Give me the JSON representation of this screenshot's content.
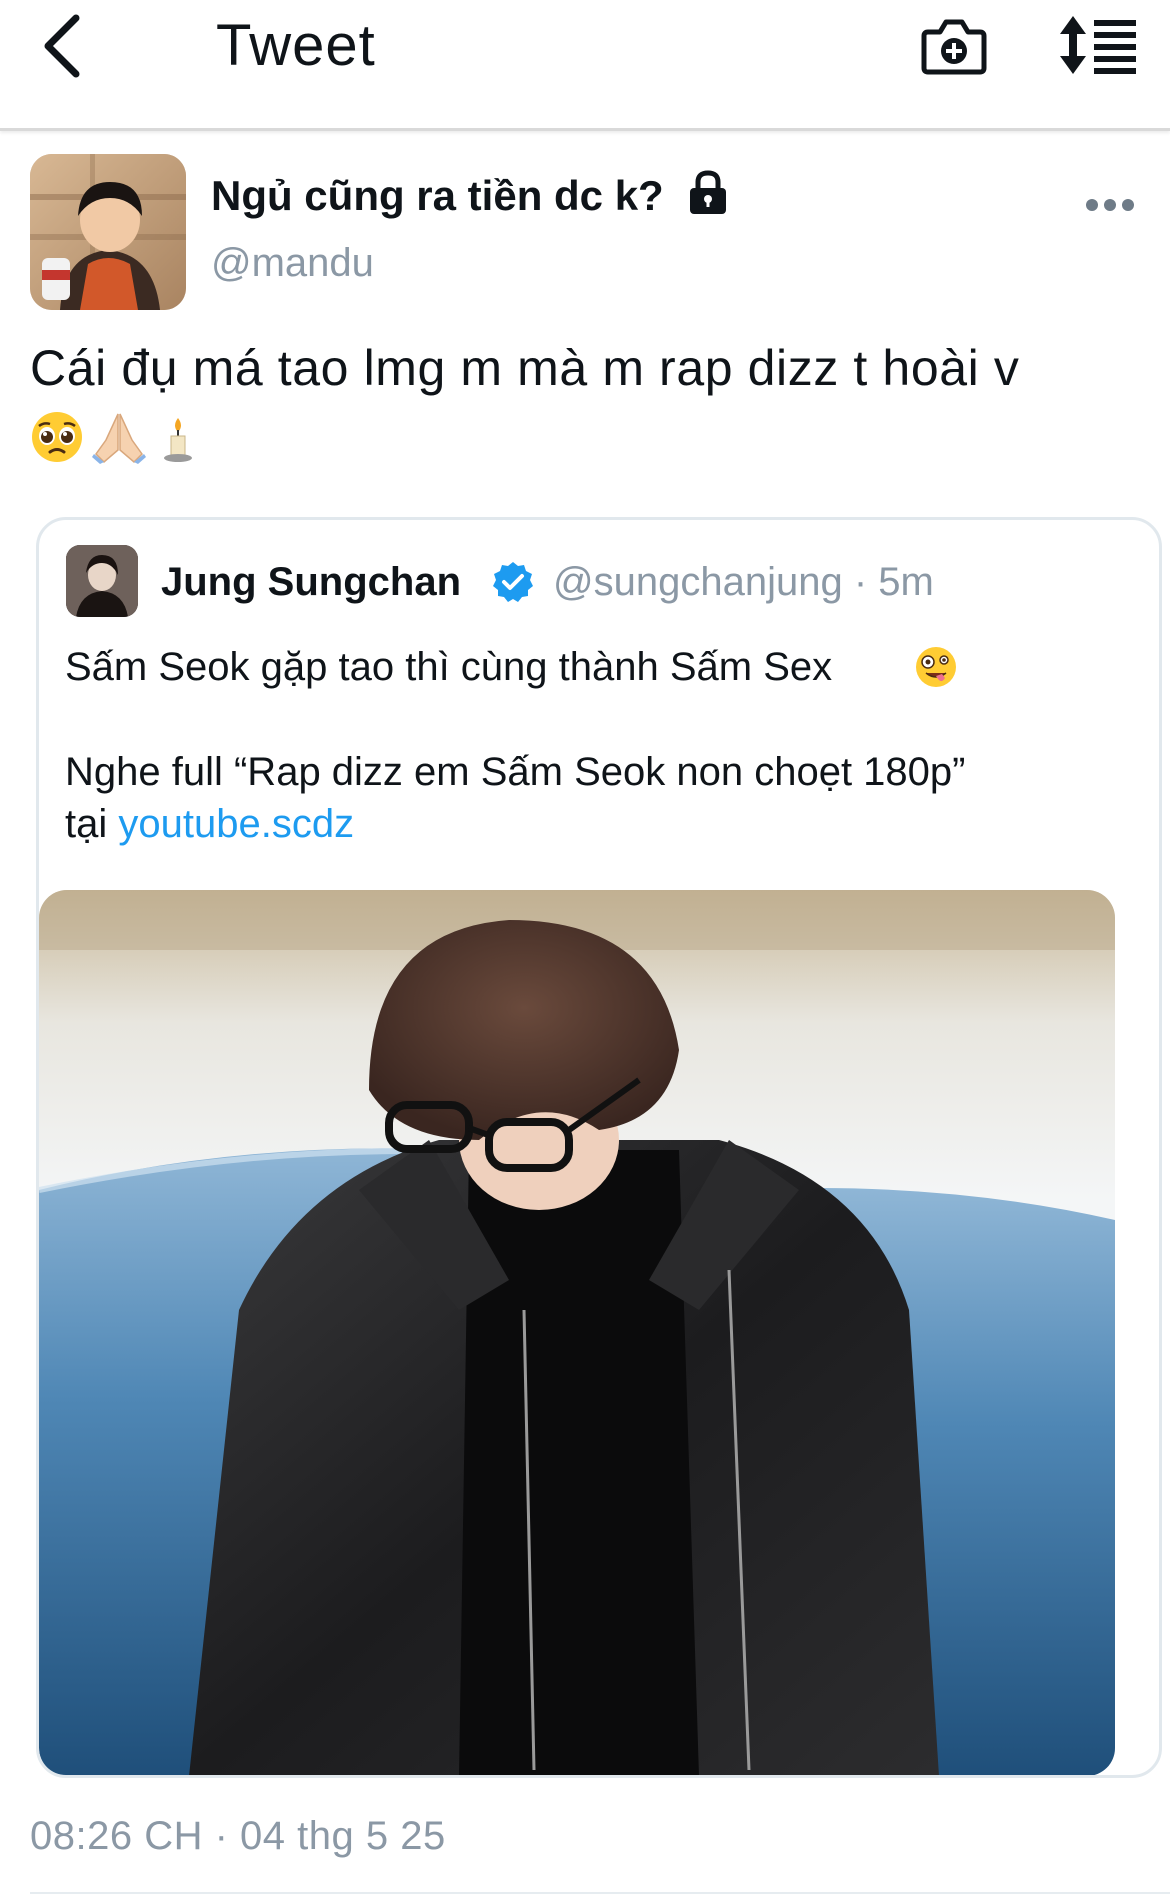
{
  "header": {
    "title": "Tweet",
    "back_icon": "chevron-left-icon",
    "camera_icon": "camera-plus-icon",
    "sort_icon": "sort-list-icon"
  },
  "author": {
    "display_name": "Ngủ cũng ra tiền dc k?",
    "handle": "@mandu",
    "protected_icon": "lock-icon",
    "more_icon": "more-dots-icon"
  },
  "tweet": {
    "text": "Cái đụ má tao lmg m mà m rap dizz t hoài v",
    "emojis": [
      "pleading-face",
      "folded-hands",
      "candle"
    ]
  },
  "quote": {
    "display_name": "Jung Sungchan",
    "verified": true,
    "handle": "@sungchanjung",
    "separator": "·",
    "time": "5m",
    "line1": "Sấm Seok gặp tao thì cùng thành Sấm Sex",
    "line1_emoji": "zany-face",
    "line2": "Nghe full “Rap dizz em Sấm Seok non choẹt 180p”",
    "line3_prefix": "tại",
    "link": "youtube.scdz"
  },
  "timestamp": "08:26 CH · 04 thg 5 25",
  "colors": {
    "text": "#0f1419",
    "secondary": "#8b98a5",
    "link": "#1d9bf0",
    "border": "#e1e8ed"
  }
}
